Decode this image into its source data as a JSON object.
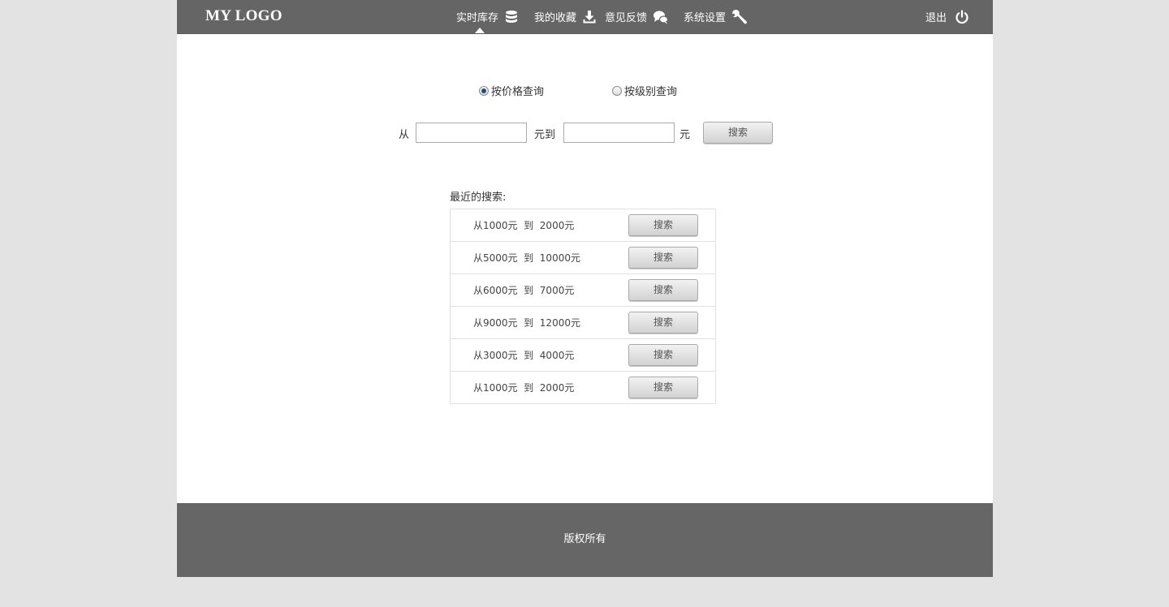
{
  "header": {
    "logo": "MY LOGO",
    "nav": [
      {
        "label": "实时库存",
        "icon": "database-icon"
      },
      {
        "label": "我的收藏",
        "icon": "download-icon"
      },
      {
        "label": "意见反馈",
        "icon": "chat-bubbles-icon"
      },
      {
        "label": "系统设置",
        "icon": "wrench-icon"
      }
    ],
    "logout": {
      "label": "退出",
      "icon": "power-icon"
    }
  },
  "query": {
    "mode_price": "按价格查询",
    "mode_level": "按级别查询",
    "selected_mode": "按价格查询",
    "from_label": "从",
    "yuan_to_label": "元到",
    "yuan_label": "元",
    "from_value": "",
    "to_value": "",
    "search_button": "搜索"
  },
  "recent": {
    "title": "最近的搜索:",
    "items": [
      {
        "text": "从1000元  到  2000元",
        "button": "搜索"
      },
      {
        "text": "从5000元  到  10000元",
        "button": "搜索"
      },
      {
        "text": "从6000元  到  7000元",
        "button": "搜索"
      },
      {
        "text": "从9000元  到  12000元",
        "button": "搜索"
      },
      {
        "text": "从3000元  到  4000元",
        "button": "搜索"
      },
      {
        "text": "从1000元  到  2000元",
        "button": "搜索"
      }
    ]
  },
  "footer": {
    "copyright": "版权所有"
  }
}
